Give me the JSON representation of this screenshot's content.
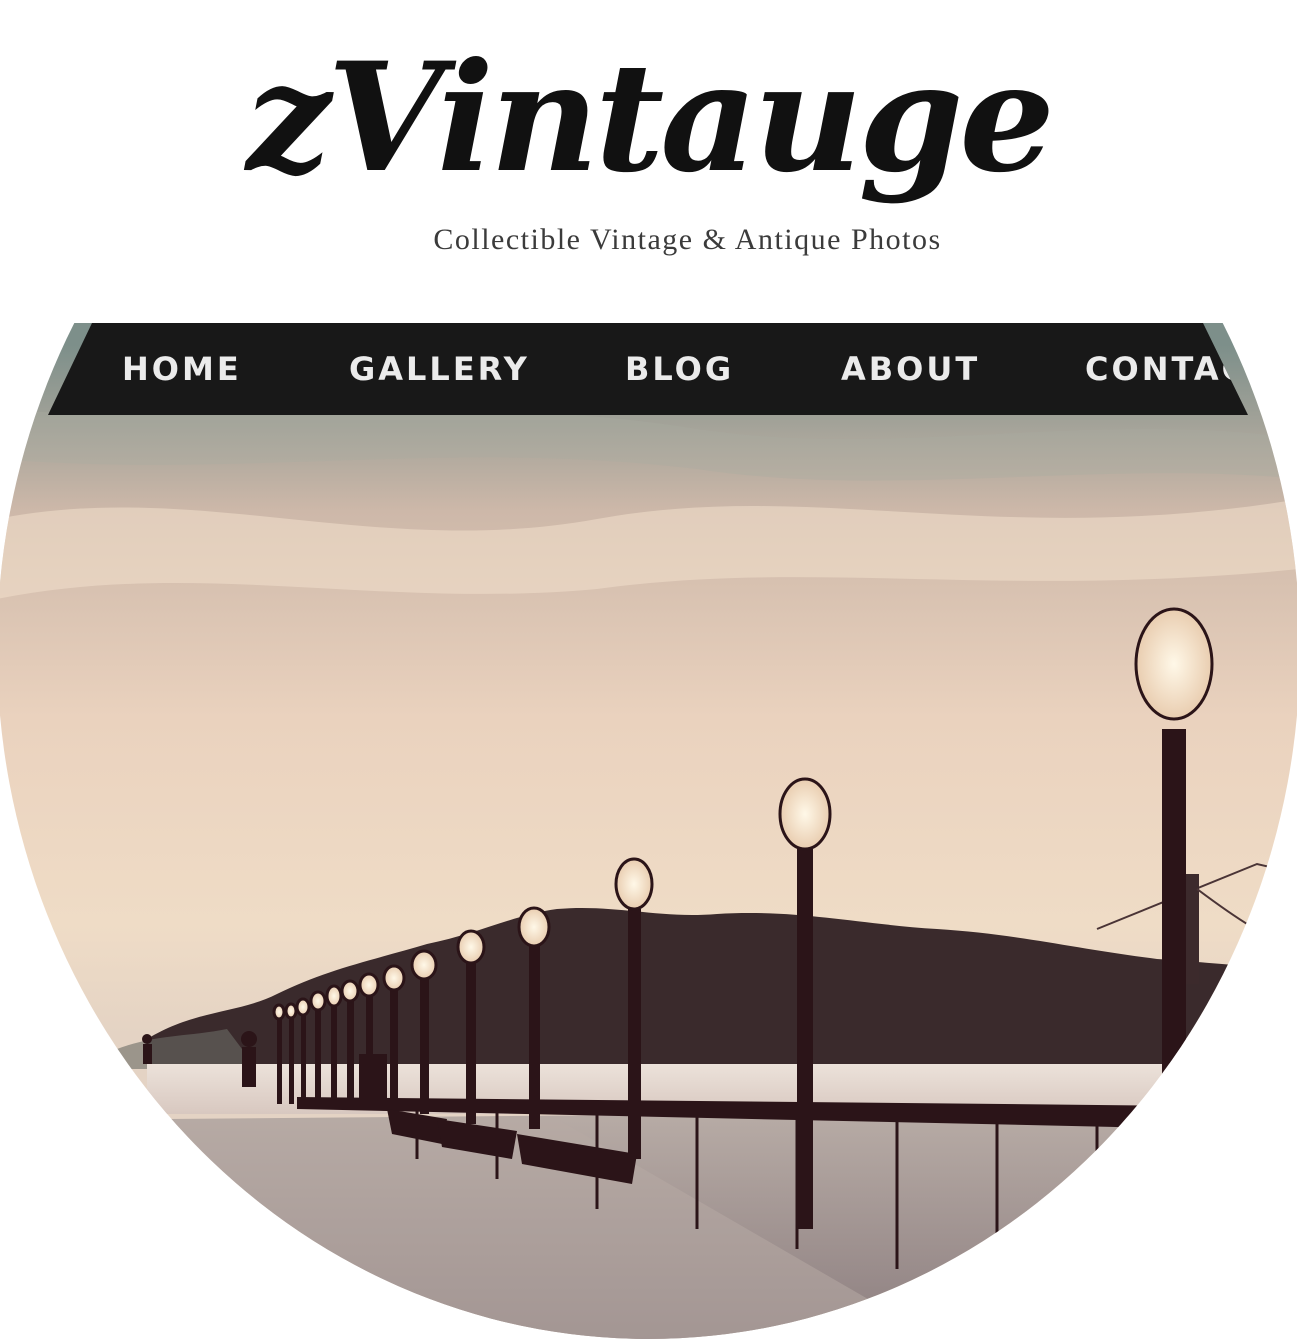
{
  "site": {
    "title": "zVintauge",
    "tagline": "Collectible Vintage & Antique Photos"
  },
  "nav": {
    "items": [
      {
        "label": "HOME"
      },
      {
        "label": "GALLERY"
      },
      {
        "label": "BLOG"
      },
      {
        "label": "ABOUT"
      },
      {
        "label": "CONTACT"
      }
    ]
  },
  "hero": {
    "alt": "Sepia photo of a waterfront pier with a row of lamp posts, benches and a bridge in the distance",
    "colors": {
      "sky_top": "#7d8f8a",
      "sky_mid": "#dcc2b0",
      "sky_low": "#efd8c2",
      "water": "#e6d8cf",
      "hills": "#3a2a2c",
      "posts": "#2b1418",
      "lamp_glow": "#f6ead6",
      "deck": "#a89a98"
    }
  }
}
